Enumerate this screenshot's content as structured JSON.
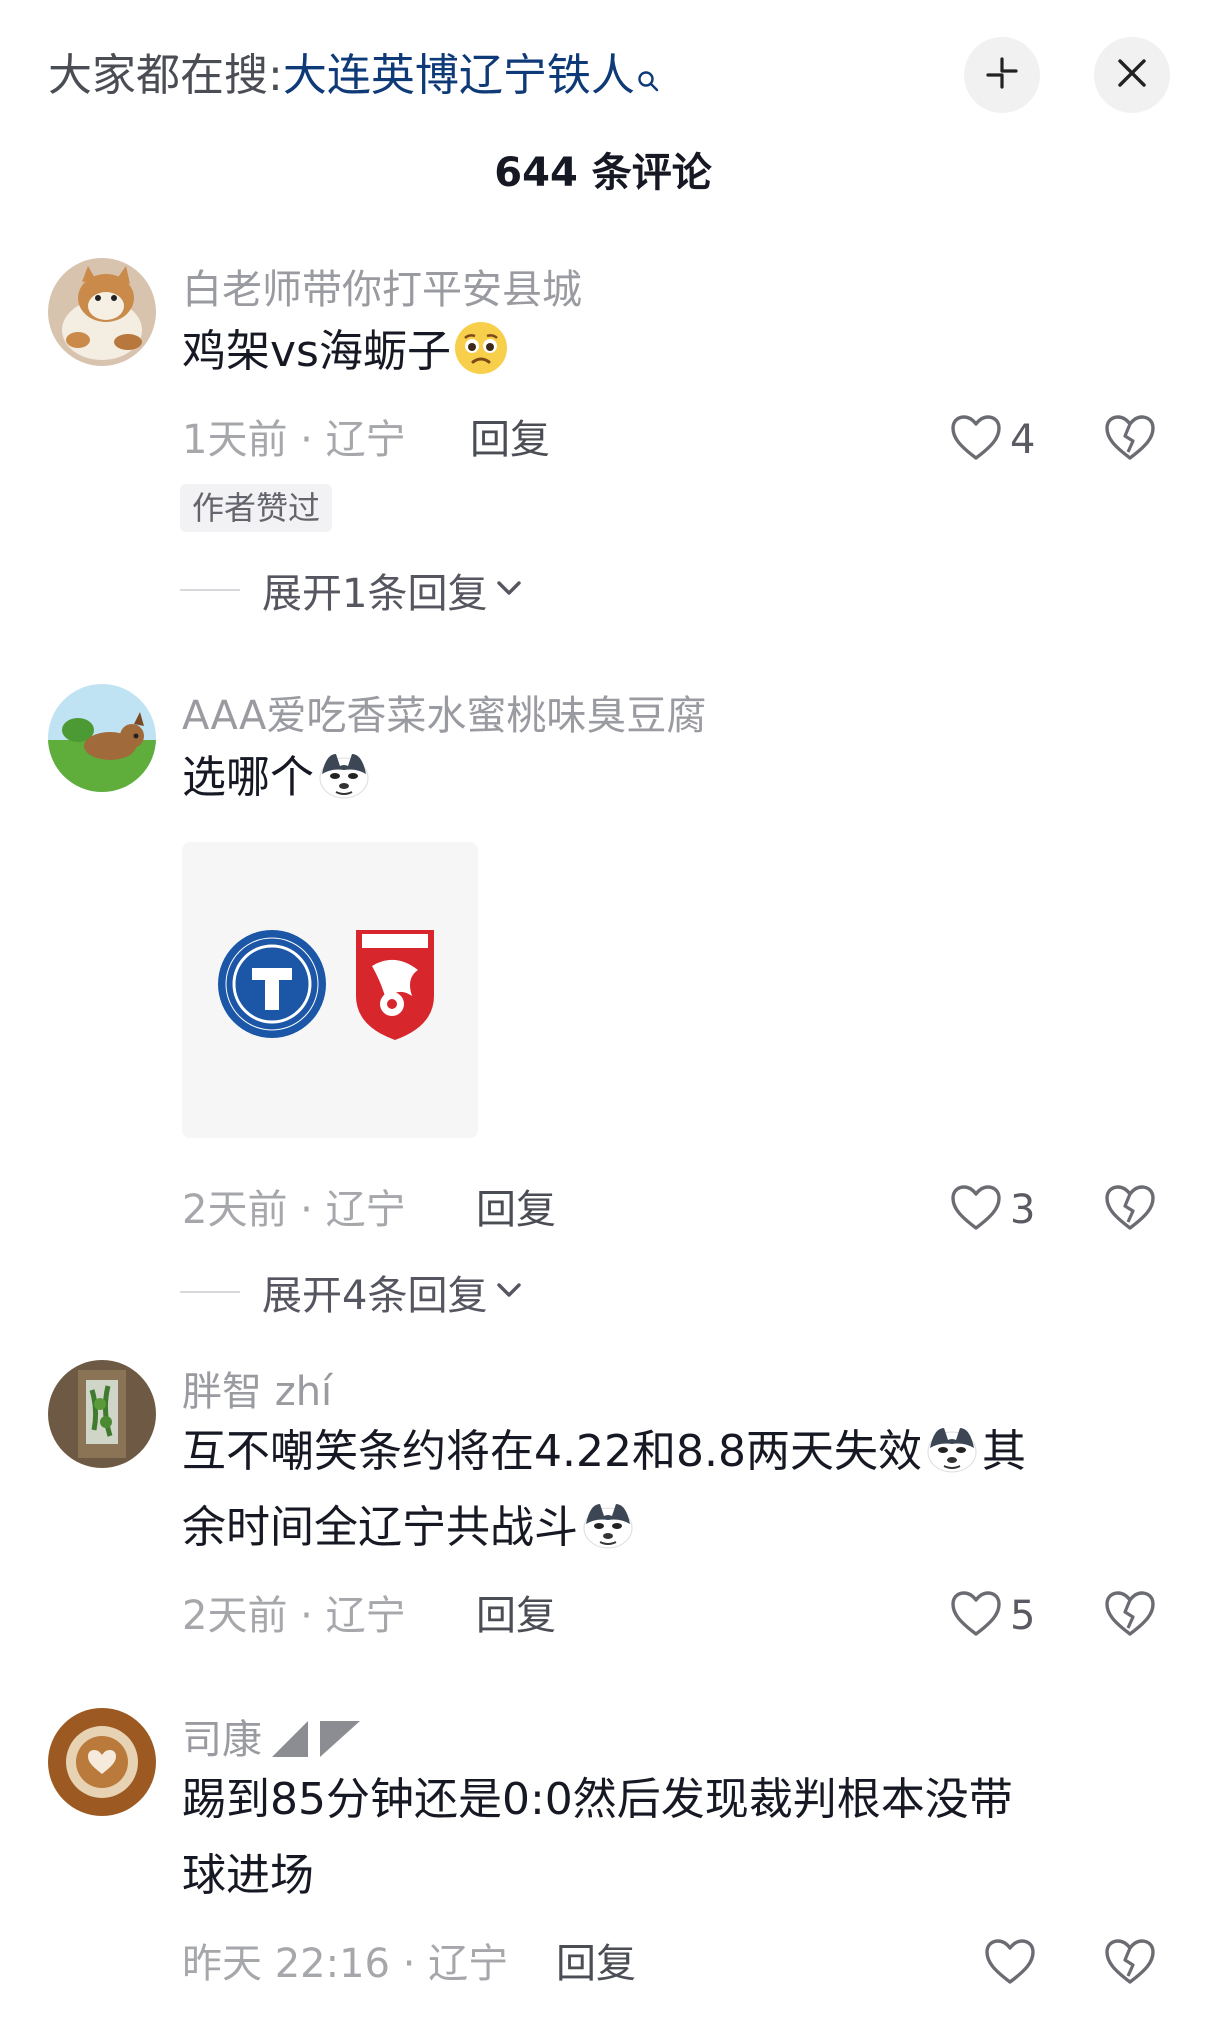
{
  "header": {
    "search_prefix": "大家都在搜:",
    "search_keyword": "大连英博辽宁铁人",
    "comment_count": "644 条评论"
  },
  "comments": [
    {
      "username": "白老师带你打平安县城",
      "text": "鸡架vs海蛎子",
      "time_location": "1天前 · 辽宁",
      "reply_label": "回复",
      "likes": "4",
      "badge": "作者赞过",
      "expand_label": "展开1条回复"
    },
    {
      "username": "AAA爱吃香菜水蜜桃味臭豆腐",
      "text": "选哪个",
      "time_location": "2天前 · 辽宁",
      "reply_label": "回复",
      "likes": "3",
      "expand_label": "展开4条回复",
      "image_logos": [
        "LIAONING TIEREN FOOTBALL CLUB",
        "DALIAN YINGBO"
      ]
    },
    {
      "username": "胖智 zhí",
      "text_line1": "互不嘲笑条约将在4.22和8.8两天失效",
      "text_line1_tail": "其",
      "text_line2": "余时间全辽宁共战斗",
      "time_location": "2天前 · 辽宁",
      "reply_label": "回复",
      "likes": "5"
    },
    {
      "username": "司康",
      "text_line1": "踢到85分钟还是0:0然后发现裁判根本没带",
      "text_line2": "球进场",
      "time_location": "昨天 22:16 · 辽宁",
      "reply_label": "回复"
    }
  ],
  "icons": {
    "search": "search-icon",
    "collapse": "collapse-icon",
    "close": "close-icon",
    "like": "heart-icon",
    "dislike": "broken-heart-icon",
    "chevron": "chevron-down-icon"
  },
  "colors": {
    "keyword": "#0e3a78",
    "muted": "#9a9ba0",
    "text": "#161823"
  }
}
